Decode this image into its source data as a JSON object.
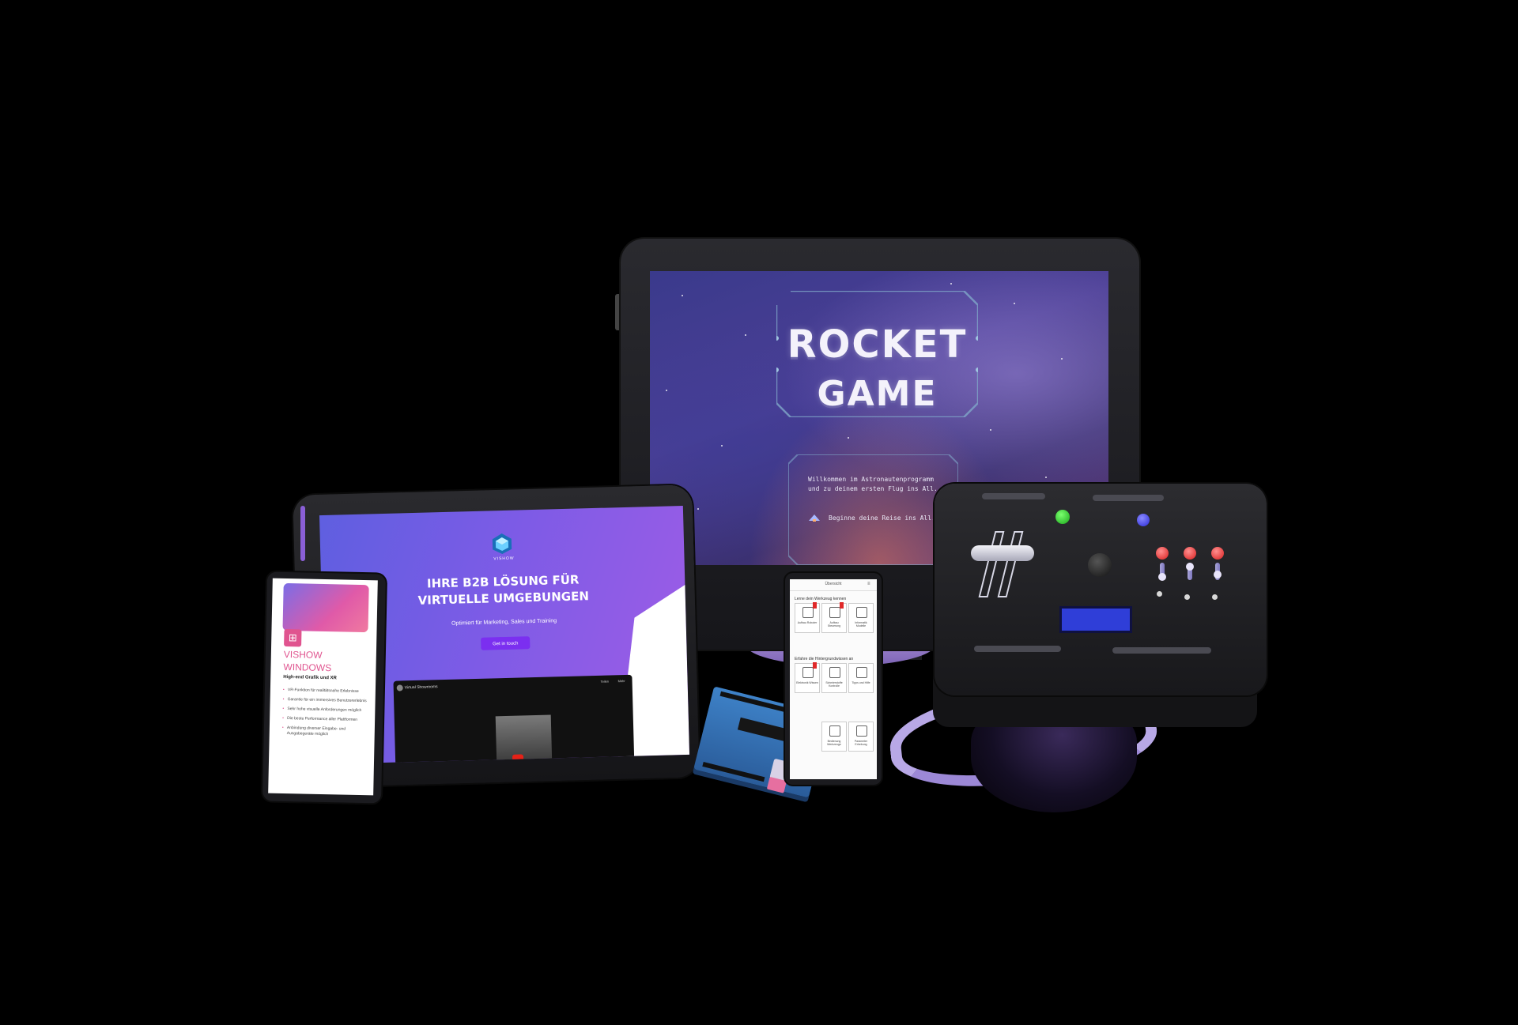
{
  "monitor": {
    "game_title_line1": "ROCKET",
    "game_title_line2": "GAME",
    "welcome_text": "Willkommen im Astronautenprogramm und zu deinem ersten Flug ins All.",
    "start_text": "Beginne deine Reise ins All.",
    "icon": "rocket-icon"
  },
  "tablet": {
    "logo_label": "VISHOW",
    "hero_title": "IHRE B2B LÖSUNG FÜR VIRTUELLE UMGEBUNGEN",
    "hero_subtitle": "Optimiert für Marketing, Sales und Training",
    "cta_label": "Get in touch",
    "video": {
      "title": "Virtual Showrooms",
      "share_label": "Teilen",
      "more_label": "Mehr"
    }
  },
  "phone_left": {
    "title": "VISHOW WINDOWS",
    "subtitle": "High-end Grafik und XR",
    "features": [
      "VR-Funktion für realitätsnahe Erlebnisse",
      "Garantie für ein immersives Benutzererlebnis",
      "Sehr hohe visuelle Anforderungen möglich",
      "Die beste Performance aller Plattformen",
      "Anbindung diverser Eingabe- und Ausgabegeräte möglich"
    ]
  },
  "phone_right": {
    "header_title": "Übersicht",
    "section1": "Lerne dein Werkzeug kennen",
    "section2": "Erfahre die Hintergrundwissen an",
    "tiles_row1": [
      "Aufbau Roboter",
      "Aufbau Steuerung",
      "Informatik Modelle"
    ],
    "tiles_row2": [
      "Elektronik Wissen",
      "Schmierstoffe Kontrolle",
      "Tipps und Hilfe"
    ],
    "tiles_row3": [
      "Bedienung Werkzeuge",
      "Parameter Erhebung"
    ]
  },
  "colors": {
    "accent_purple": "#7b2ff0",
    "brand_pink": "#e0548f",
    "panel_green": "#1aa71a",
    "panel_blue": "#2a2ad6",
    "panel_red": "#d81e1e",
    "lcd_blue": "#2f3ed8"
  }
}
